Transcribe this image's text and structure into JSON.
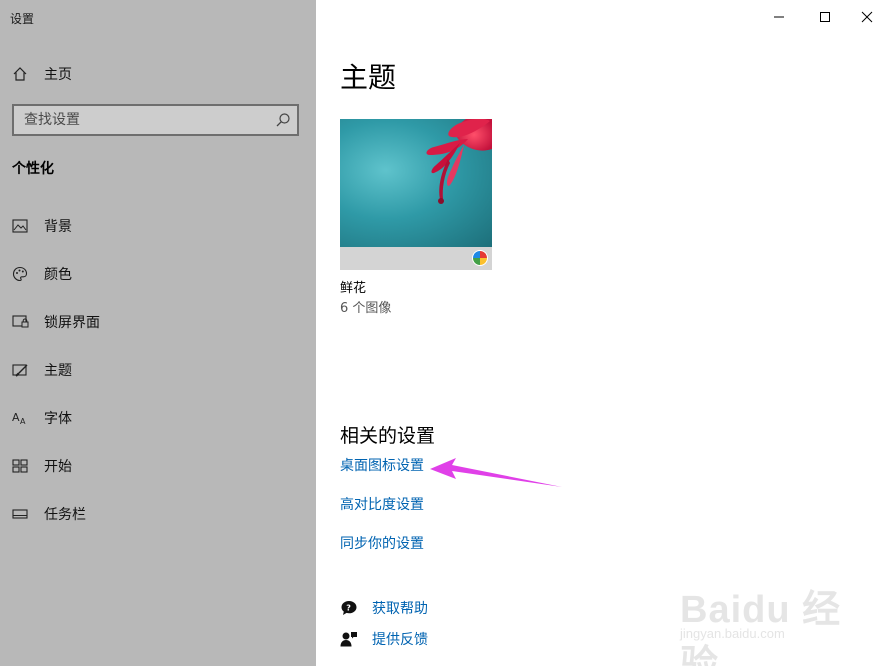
{
  "window": {
    "title": "设置",
    "minimize_icon": "minimize-icon",
    "maximize_icon": "maximize-icon",
    "close_icon": "close-icon"
  },
  "sidebar": {
    "home_label": "主页",
    "search_placeholder": "查找设置",
    "section_label": "个性化",
    "items": [
      {
        "label": "背景",
        "icon": "picture-icon"
      },
      {
        "label": "颜色",
        "icon": "palette-icon"
      },
      {
        "label": "锁屏界面",
        "icon": "lock-screen-icon"
      },
      {
        "label": "主题",
        "icon": "theme-brush-icon"
      },
      {
        "label": "字体",
        "icon": "font-icon"
      },
      {
        "label": "开始",
        "icon": "start-grid-icon"
      },
      {
        "label": "任务栏",
        "icon": "taskbar-icon"
      }
    ]
  },
  "main": {
    "title": "主题",
    "theme": {
      "name": "鲜花",
      "count": "6 个图像"
    },
    "related_title": "相关的设置",
    "links": [
      "桌面图标设置",
      "高对比度设置",
      "同步你的设置"
    ],
    "help": [
      {
        "label": "获取帮助",
        "icon": "help-chat-icon"
      },
      {
        "label": "提供反馈",
        "icon": "feedback-icon"
      }
    ]
  },
  "annotation": {
    "arrow_color": "#e040e8"
  },
  "watermark": {
    "main": "Baidu 经验",
    "sub": "jingyan.baidu.com"
  },
  "colors": {
    "sidebar_bg": "#b8b8b8",
    "link": "#0063b1"
  }
}
